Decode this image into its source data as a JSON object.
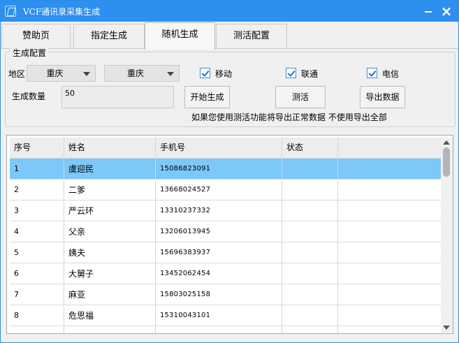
{
  "window": {
    "title": "VCF通讯录采集生成"
  },
  "tabs": [
    {
      "label": "赞助页"
    },
    {
      "label": "指定生成"
    },
    {
      "label": "随机生成"
    },
    {
      "label": "测活配置"
    }
  ],
  "group": {
    "title": "生成配置",
    "region_label": "地区",
    "province": "重庆",
    "city": "重庆",
    "carriers": [
      {
        "label": "移动",
        "checked": true
      },
      {
        "label": "联通",
        "checked": true
      },
      {
        "label": "电信",
        "checked": true
      }
    ],
    "count_label": "生成数量",
    "count_value": "50",
    "buttons": {
      "start": "开始生成",
      "test": "测活",
      "export": "导出数据"
    },
    "note": "如果您使用测活功能将导出正常数据 不使用导出全部"
  },
  "table": {
    "columns": [
      "序号",
      "姓名",
      "手机号",
      "状态",
      ""
    ],
    "rows": [
      {
        "index": "1",
        "name": "虞迎民",
        "phone": "15086823091",
        "status": ""
      },
      {
        "index": "2",
        "name": "二爹",
        "phone": "13668024527",
        "status": ""
      },
      {
        "index": "3",
        "name": "严云环",
        "phone": "13310237332",
        "status": ""
      },
      {
        "index": "4",
        "name": "父亲",
        "phone": "13206013945",
        "status": ""
      },
      {
        "index": "5",
        "name": "姨夫",
        "phone": "15696383937",
        "status": ""
      },
      {
        "index": "6",
        "name": "大舅子",
        "phone": "13452062454",
        "status": ""
      },
      {
        "index": "7",
        "name": "麻亚",
        "phone": "15803025158",
        "status": ""
      },
      {
        "index": "8",
        "name": "危思福",
        "phone": "15310043101",
        "status": ""
      }
    ]
  }
}
